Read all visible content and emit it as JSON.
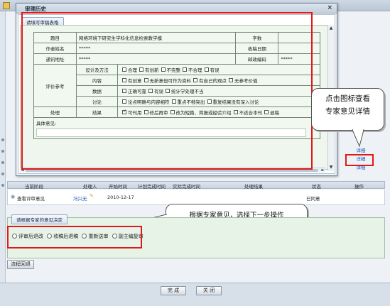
{
  "dialog": {
    "title": "审理历史",
    "close_glyph": "×",
    "tab_label": "请填写审稿表格"
  },
  "form": {
    "title_label": "题目",
    "title_value": "网络环境下研究生学科化信息检索教学模",
    "word_count_label": "字数",
    "author_label": "作者姓名",
    "author_value": "*****",
    "received_date_label": "收稿日期",
    "address_label": "通讯地址",
    "address_value": "*****",
    "postcode_label": "邮政编码",
    "postcode_value": "*****",
    "eval_label": "评价参考",
    "eval_rows": [
      {
        "name": "设计及方法",
        "options": [
          {
            "label": "合理",
            "checked": false
          },
          {
            "label": "有创新",
            "checked": false
          },
          {
            "label": "不完整",
            "checked": false
          },
          {
            "label": "不合理",
            "checked": false
          },
          {
            "label": "有误",
            "checked": false
          }
        ]
      },
      {
        "name": "内容",
        "options": [
          {
            "label": "有创意",
            "checked": false
          },
          {
            "label": "无新意但可作为资料",
            "checked": false
          },
          {
            "label": "有自己的观点",
            "checked": false
          },
          {
            "label": "无参考价值",
            "checked": false
          }
        ]
      },
      {
        "name": "数据",
        "options": [
          {
            "label": "正确可靠",
            "checked": false
          },
          {
            "label": "有误",
            "checked": false
          },
          {
            "label": "统计学处理不当",
            "checked": false
          }
        ]
      },
      {
        "name": "讨论",
        "options": [
          {
            "label": "论点明确与内容相符",
            "checked": false
          },
          {
            "label": "重点不够突出",
            "checked": false
          },
          {
            "label": "重复结果没有深入讨论",
            "checked": false
          }
        ]
      }
    ],
    "handle_label": "处理",
    "result_label": "结果",
    "result_options": [
      {
        "label": "可刊用",
        "checked": true
      },
      {
        "label": "修后再审",
        "checked": false
      },
      {
        "label": "改为短篇、简报或经验介绍",
        "checked": false
      },
      {
        "label": "不适合本刊",
        "checked": false
      },
      {
        "label": "退稿",
        "checked": false
      }
    ],
    "comments_label": "具体意见:"
  },
  "scroll": {
    "up": "▲",
    "down": "▼",
    "left": "◄",
    "right": "►"
  },
  "links": [
    "详细",
    "详细",
    "详细"
  ],
  "callouts": {
    "detail_line1": "点击图标查看",
    "detail_line2": "专家意见详情",
    "decision": "根据专家意见，选择下一步操作"
  },
  "process": {
    "headers": [
      "当前阶段",
      "处理人",
      "开始时间",
      "计划完成时间",
      "实际完成时间",
      "处理结果",
      "状态",
      "操作"
    ],
    "row": {
      "stage": "查看评审意见",
      "handler": "冯兴无",
      "start": "2010-12-17",
      "status": "已同意"
    }
  },
  "decision": {
    "tab_label": "请根据专家的意见决定",
    "options": [
      "评审后退改",
      "收稿后退稿",
      "重新送审",
      "副主编复审"
    ]
  },
  "buttons": {
    "flow_back": "流程回退",
    "done": "完 成",
    "close": "关 闭"
  },
  "colors": {
    "highlight": "#e01818",
    "link": "#1b57b8"
  }
}
